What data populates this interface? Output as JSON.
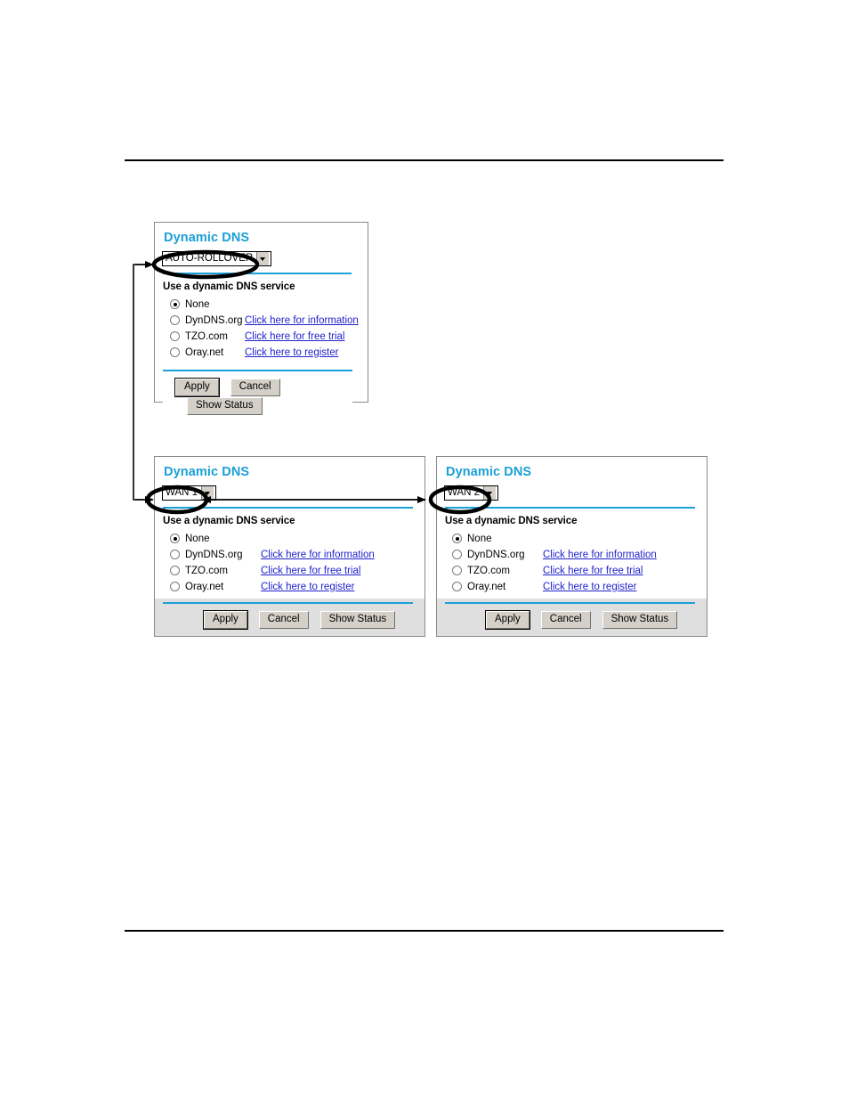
{
  "document": {
    "header_rule": true,
    "footer_rule": true
  },
  "colors": {
    "title": "#1ba0d7",
    "divider": "#1ba0d7",
    "link": "#2222cc",
    "button_face": "#d4d0c8",
    "panel_border": "#8a8a8a",
    "annotation": "#000000"
  },
  "panels": [
    {
      "id": "rollover",
      "title": "Dynamic DNS",
      "selected_interface": "AUTO-ROLLOVER",
      "section_label": "Use a dynamic DNS service",
      "services": [
        {
          "label": "None",
          "checked": true,
          "link": ""
        },
        {
          "label": "DynDNS.org",
          "checked": false,
          "link": "Click here for information"
        },
        {
          "label": "TZO.com",
          "checked": false,
          "link": "Click here for free trial"
        },
        {
          "label": "Oray.net",
          "checked": false,
          "link": "Click here to register"
        }
      ],
      "buttons": {
        "apply": "Apply",
        "cancel": "Cancel",
        "show_status": "Show Status"
      }
    },
    {
      "id": "wan1",
      "title": "Dynamic DNS",
      "selected_interface": "WAN 1",
      "section_label": "Use a dynamic DNS service",
      "services": [
        {
          "label": "None",
          "checked": true,
          "link": ""
        },
        {
          "label": "DynDNS.org",
          "checked": false,
          "link": "Click here for information"
        },
        {
          "label": "TZO.com",
          "checked": false,
          "link": "Click here for free trial"
        },
        {
          "label": "Oray.net",
          "checked": false,
          "link": "Click here to register"
        }
      ],
      "buttons": {
        "apply": "Apply",
        "cancel": "Cancel",
        "show_status": "Show Status"
      }
    },
    {
      "id": "wan2",
      "title": "Dynamic DNS",
      "selected_interface": "WAN 2",
      "section_label": "Use a dynamic DNS service",
      "services": [
        {
          "label": "None",
          "checked": true,
          "link": ""
        },
        {
          "label": "DynDNS.org",
          "checked": false,
          "link": "Click here for information"
        },
        {
          "label": "TZO.com",
          "checked": false,
          "link": "Click here for free trial"
        },
        {
          "label": "Oray.net",
          "checked": false,
          "link": "Click here to register"
        }
      ],
      "buttons": {
        "apply": "Apply",
        "cancel": "Cancel",
        "show_status": "Show Status"
      }
    }
  ],
  "annotations": {
    "ellipses": [
      {
        "target": "AUTO-ROLLOVER"
      },
      {
        "target": "WAN 1"
      },
      {
        "target": "WAN 2"
      }
    ],
    "connectors": [
      {
        "from": "AUTO-ROLLOVER",
        "to": "WAN 1",
        "style": "elbow-double-head"
      },
      {
        "from": "WAN 1",
        "to": "WAN 2",
        "style": "straight-double-head"
      }
    ]
  }
}
